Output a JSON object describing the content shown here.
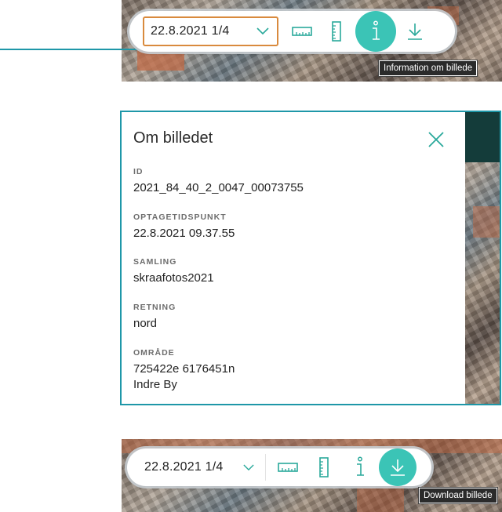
{
  "toolbar_top": {
    "date_label": "22.8.2021 1/4",
    "tooltip": "Information om billede",
    "active_button": "info"
  },
  "info_panel": {
    "title": "Om billedet",
    "fields": [
      {
        "label": "ID",
        "value": "2021_84_40_2_0047_00073755"
      },
      {
        "label": "OPTAGETIDSPUNKT",
        "value": "22.8.2021 09.37.55"
      },
      {
        "label": "SAMLING",
        "value": "skraafotos2021"
      },
      {
        "label": "RETNING",
        "value": "nord"
      },
      {
        "label": "OMRÅDE",
        "value": "725422e 6176451n",
        "value2": "Indre By"
      }
    ]
  },
  "toolbar_bottom": {
    "date_label": "22.8.2021 1/4",
    "tooltip": "Download billede",
    "active_button": "download"
  },
  "colors": {
    "accent": "#3bc4b6",
    "highlight_orange": "#d98a3d",
    "panel_border": "#1e97a8"
  },
  "icons": [
    "chevron-down-icon",
    "ruler-horizontal-icon",
    "ruler-vertical-icon",
    "info-icon",
    "download-icon",
    "close-icon"
  ]
}
